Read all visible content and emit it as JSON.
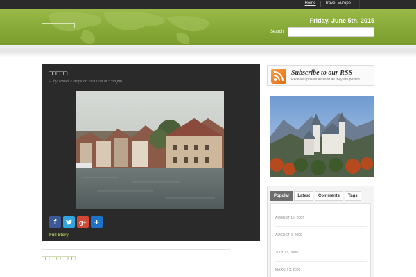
{
  "topnav": {
    "home": "Home",
    "site": "Travel Europe"
  },
  "header": {
    "date": "Friday, June 5th, 2015",
    "search_label": "Search",
    "search_value": ""
  },
  "post": {
    "title": "□□□□□",
    "meta": "by Travel Europe on 28/11/08 at 5:38 pm",
    "full_story": "Full Story"
  },
  "next_post_title": "□□□□□□□□□",
  "sidebar": {
    "rss_title": "Subscribe to our RSS",
    "rss_sub": "Receive updates as soon as they are posted",
    "tabs": [
      "Popular",
      "Latest",
      "Comments",
      "Tags"
    ],
    "dates": [
      "AUGUST 15, 2007",
      "AUGUST 9, 2009",
      "JULY 13, 2009",
      "MARCH 3, 2009"
    ]
  },
  "colors": {
    "header_green": "#86a937",
    "post_bg": "#2a2a2a",
    "link_green": "#a6c55c"
  }
}
